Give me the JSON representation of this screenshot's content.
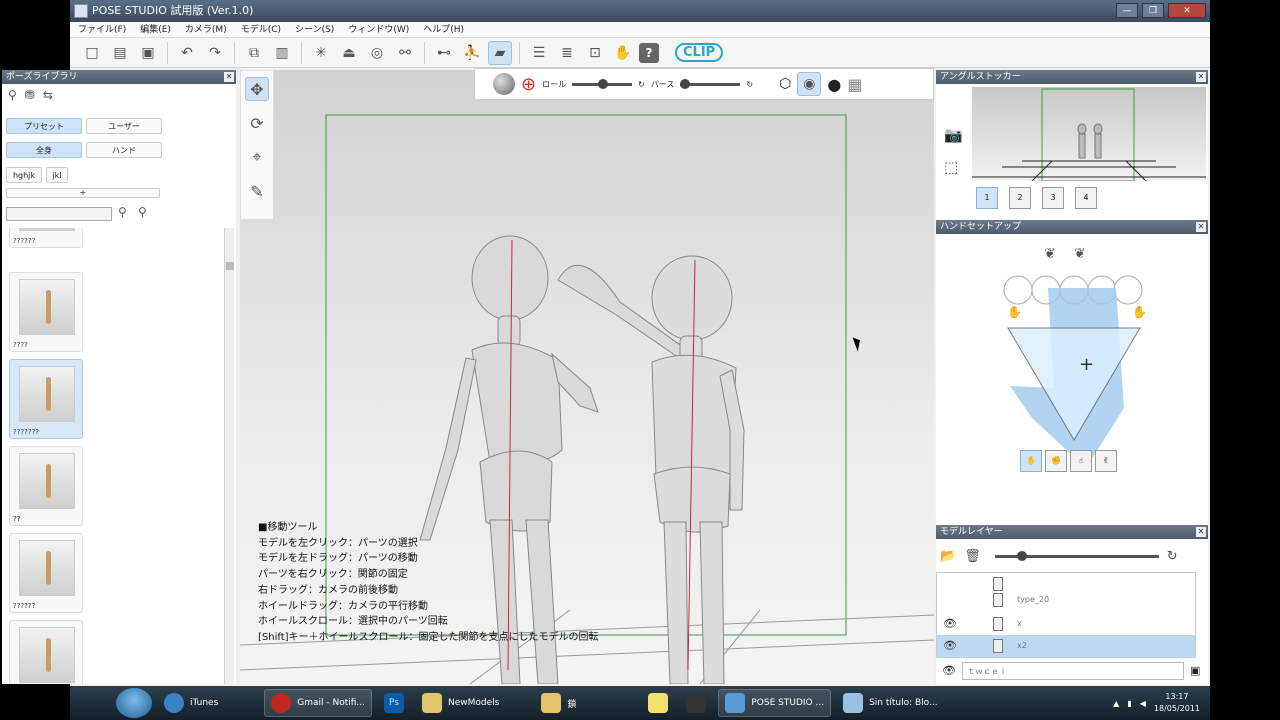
{
  "window": {
    "title": "POSE STUDIO 試用版 (Ver.1.0)",
    "buttons": [
      "—",
      "❐",
      "✕"
    ]
  },
  "menu": [
    "ファイル(F)",
    "編集(E)",
    "カメラ(M)",
    "モデル(C)",
    "シーン(S)",
    "ウィンドウ(W)",
    "ヘルプ(H)"
  ],
  "toolbar": {
    "clip_label": "CLIP",
    "help_label": "?"
  },
  "pose_library": {
    "title": "ポーズライブラリ",
    "tabs1": [
      "プリセット",
      "ユーザー"
    ],
    "tabs2": [
      "全身",
      "ハンド"
    ],
    "tags": [
      "hghjk",
      "jkl"
    ],
    "add_label": "+",
    "thumbs": [
      {
        "caption": "??????"
      },
      {
        "caption": "????"
      },
      {
        "caption": "???????"
      },
      {
        "caption": "??"
      },
      {
        "caption": "??????"
      },
      {
        "caption": ""
      }
    ]
  },
  "viewport": {
    "roll_label": "ロール",
    "perspective_label": "パース",
    "help_lines": [
      "■移動ツール",
      "モデルを左クリック：パーツの選択",
      "モデルを左ドラッグ：パーツの移動",
      "パーツを右クリック：関節の固定",
      "右ドラッグ：カメラの前後移動",
      "ホイールドラッグ：カメラの平行移動",
      "ホイールスクロール：選択中のパーツ回転",
      "[Shift]キー＋ホイールスクロール：固定した関節を支点にしたモデルの回転"
    ]
  },
  "angle_stocker": {
    "title": "アングルストッカー",
    "slots": [
      "1",
      "2",
      "3",
      "4"
    ]
  },
  "hand_setup": {
    "title": "ハンドセットアップ",
    "center_mark": "+"
  },
  "model_layer": {
    "title": "モデルレイヤー",
    "layers": [
      {
        "name": "",
        "visible": false,
        "selected": false
      },
      {
        "name": "type_20",
        "visible": false,
        "selected": false
      },
      {
        "name": "x",
        "visible": true,
        "selected": false
      },
      {
        "name": "x2",
        "visible": true,
        "selected": true
      }
    ],
    "new_layer_placeholder": "ｔｗｃｅｉ"
  },
  "taskbar": {
    "items": [
      {
        "label": "iTunes",
        "color": "#3b7fc4"
      },
      {
        "label": "Gmail - Notifi...",
        "color": "#c0271d"
      },
      {
        "label": "",
        "color": "#0b5ea6",
        "text": "Ps"
      },
      {
        "label": "NewModels",
        "color": "#e3c46a"
      },
      {
        "label": "鎖",
        "color": "#e3c46a"
      },
      {
        "label": "",
        "color": "#f2e06f"
      },
      {
        "label": "",
        "color": "#333"
      },
      {
        "label": "POSE STUDIO ...",
        "color": "#5a9bd5"
      },
      {
        "label": "Sin título: Blo...",
        "color": "#9bc1e2"
      }
    ],
    "time": "13:17",
    "date": "18/05/2011"
  }
}
